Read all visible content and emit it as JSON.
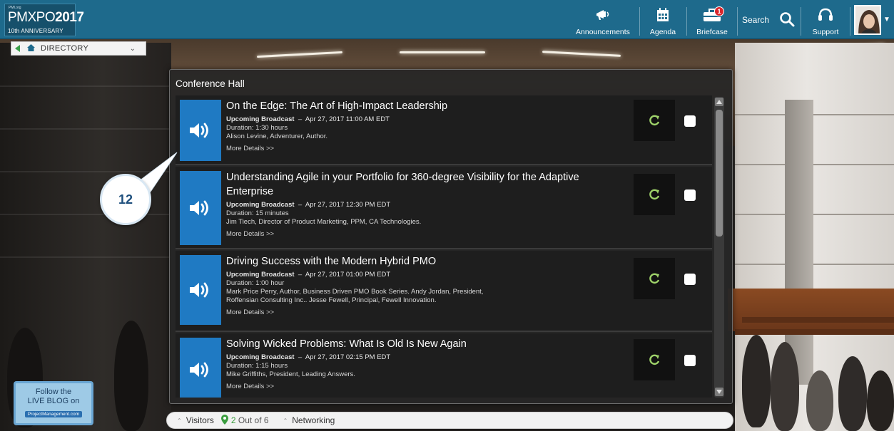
{
  "header": {
    "logo": {
      "small": "PMI.org",
      "main_a": "PMXPO",
      "main_b": "2017",
      "sub": "10th ANNIVERSARY"
    },
    "nav": [
      {
        "label": "Announcements",
        "icon": "megaphone-icon"
      },
      {
        "label": "Agenda",
        "icon": "calendar-icon"
      },
      {
        "label": "Briefcase",
        "icon": "briefcase-icon",
        "badge": "1"
      },
      {
        "label": "Search",
        "icon": "search-icon"
      },
      {
        "label": "Support",
        "icon": "headset-icon"
      }
    ]
  },
  "directory": {
    "label": "DIRECTORY"
  },
  "panel": {
    "title": "Conference Hall",
    "sessions": [
      {
        "title": "On the Edge: The Art of High-Impact Leadership",
        "status": "Upcoming Broadcast",
        "datetime": "Apr 27, 2017 11:00 AM EDT",
        "duration": "Duration: 1:30 hours",
        "speakers": [
          "Alison Levine, Adventurer, Author."
        ],
        "more": "More Details >>"
      },
      {
        "title": "Understanding Agile in your Portfolio for 360-degree Visibility for the Adaptive Enterprise",
        "status": "Upcoming Broadcast",
        "datetime": "Apr 27, 2017 12:30 PM EDT",
        "duration": "Duration: 15 minutes",
        "speakers": [
          "Jim Tiech, Director of Product Marketing, PPM, CA Technologies."
        ],
        "more": "More Details >>"
      },
      {
        "title": "Driving Success with the Modern Hybrid PMO",
        "status": "Upcoming Broadcast",
        "datetime": "Apr 27, 2017 01:00 PM EDT",
        "duration": "Duration: 1:00 hour",
        "speakers": [
          "Mark Price Perry, Author, Business Driven PMO Book Series. Andy Jordan, President,",
          "Roffensian Consulting Inc.. Jesse Fewell, Principal, Fewell Innovation."
        ],
        "more": "More Details >>"
      },
      {
        "title": "Solving Wicked Problems: What Is Old Is New Again",
        "status": "Upcoming Broadcast",
        "datetime": "Apr 27, 2017 02:15 PM EDT",
        "duration": "Duration: 1:15 hours",
        "speakers": [
          "Mike Griffiths, President, Leading Answers."
        ],
        "more": "More Details >>"
      }
    ]
  },
  "callout": {
    "number": "12"
  },
  "blog": {
    "line1": "Follow the",
    "line2": "LIVE BLOG on",
    "url": "ProjectManagement.com"
  },
  "bottom": {
    "visitors": "Visitors",
    "count_num": "2",
    "count_text": "Out of 6",
    "networking": "Networking"
  },
  "colors": {
    "topbar": "#1e6a8c",
    "audio_tile": "#1f7ac3",
    "panel": "#262626"
  }
}
